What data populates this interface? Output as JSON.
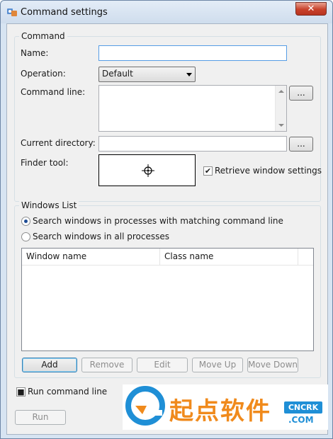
{
  "window": {
    "title": "Command settings",
    "close_label": "✕"
  },
  "command_group": {
    "title": "Command",
    "name_label": "Name:",
    "name_value": "",
    "operation_label": "Operation:",
    "operation_value": "Default",
    "command_line_label": "Command line:",
    "command_line_value": "",
    "browse_label": "...",
    "current_dir_label": "Current directory:",
    "current_dir_value": "",
    "finder_label": "Finder tool:",
    "retrieve_label": "Retrieve window settings",
    "retrieve_checked": true
  },
  "windows_list": {
    "title": "Windows List",
    "radio_matching": "Search windows in processes with matching command line",
    "radio_all": "Search windows in all processes",
    "selected_radio": "matching",
    "columns": [
      "Window name",
      "Class name"
    ],
    "rows": [],
    "buttons": {
      "add": "Add",
      "remove": "Remove",
      "edit": "Edit",
      "move_up": "Move Up",
      "move_down": "Move Down"
    }
  },
  "footer": {
    "run_cmd_label": "Run command line",
    "run_cmd_checked": true,
    "run_button": "Run"
  },
  "watermark": {
    "text": "起点软件",
    "badge": "CNCRK",
    "domain": ".COM"
  },
  "icons": {
    "app": "settings-app-icon",
    "finder": "crosshair-icon",
    "close": "close-icon"
  },
  "colors": {
    "accent_focus": "#569de5",
    "watermark_orange": "#f08a1c",
    "watermark_blue": "#1f8fd6"
  }
}
